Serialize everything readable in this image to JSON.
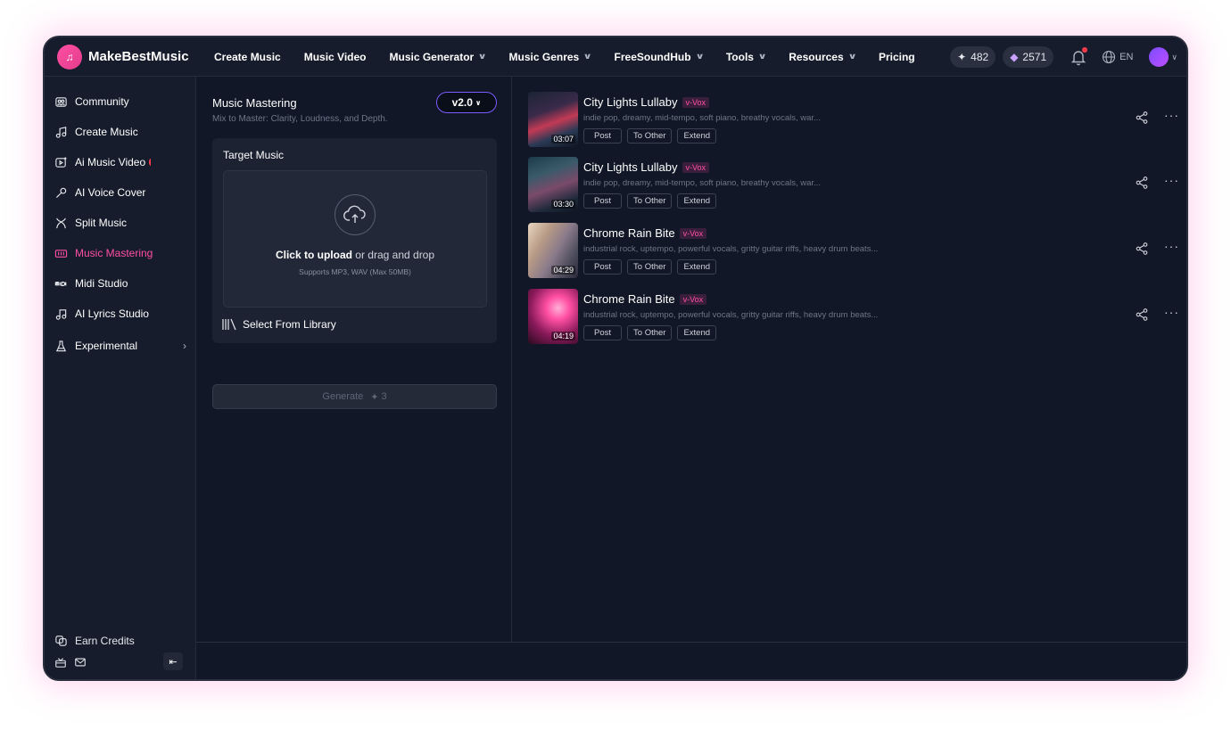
{
  "brand": {
    "name": "MakeBestMusic"
  },
  "nav": [
    {
      "label": "Create Music",
      "has_dropdown": false
    },
    {
      "label": "Music Video",
      "has_dropdown": false
    },
    {
      "label": "Music Generator",
      "has_dropdown": true
    },
    {
      "label": "Music Genres",
      "has_dropdown": true
    },
    {
      "label": "FreeSoundHub",
      "has_dropdown": true
    },
    {
      "label": "Tools",
      "has_dropdown": true
    },
    {
      "label": "Resources",
      "has_dropdown": true
    },
    {
      "label": "Pricing",
      "has_dropdown": false
    }
  ],
  "header": {
    "credits": "482",
    "gems": "2571",
    "language": "EN"
  },
  "sidebar": {
    "items": [
      {
        "label": "Community",
        "icon": "community-icon"
      },
      {
        "label": "Create Music",
        "icon": "music-note-icon"
      },
      {
        "label": "Ai Music Video",
        "icon": "video-icon"
      },
      {
        "label": "AI Voice Cover",
        "icon": "microphone-icon"
      },
      {
        "label": "Split Music",
        "icon": "split-icon"
      },
      {
        "label": "Music Mastering",
        "icon": "mastering-icon",
        "active": true
      },
      {
        "label": "Midi Studio",
        "icon": "midi-icon"
      },
      {
        "label": "AI Lyrics Studio",
        "icon": "lyrics-icon"
      },
      {
        "label": "Experimental",
        "icon": "flask-icon"
      }
    ],
    "earn_credits": "Earn Credits"
  },
  "mastering": {
    "title": "Music Mastering",
    "subtitle": "Mix to Master: Clarity, Loudness, and Depth.",
    "version": "v2.0",
    "target_label": "Target Music",
    "upload_bold": "Click to upload",
    "upload_rest": " or drag and drop",
    "upload_hint": "Supports MP3, WAV (Max 50MB)",
    "library": "Select From Library",
    "generate": "Generate",
    "generate_cost": "3"
  },
  "songs": [
    {
      "title": "City Lights Lullaby",
      "badge": "v-Vox",
      "desc": "indie pop, dreamy, mid-tempo, soft piano, breathy vocals, war...",
      "duration": "03:07"
    },
    {
      "title": "City Lights Lullaby",
      "badge": "v-Vox",
      "desc": "indie pop, dreamy, mid-tempo, soft piano, breathy vocals, war...",
      "duration": "03:30"
    },
    {
      "title": "Chrome Rain Bite",
      "badge": "v-Vox",
      "desc": "industrial rock, uptempo, powerful vocals, gritty guitar riffs, heavy drum beats...",
      "duration": "04:29"
    },
    {
      "title": "Chrome Rain Bite",
      "badge": "v-Vox",
      "desc": "industrial rock, uptempo, powerful vocals, gritty guitar riffs, heavy drum beats...",
      "duration": "04:19"
    }
  ],
  "song_actions": {
    "post": "Post",
    "to_other": "To Other",
    "extend": "Extend"
  },
  "colors": {
    "accent": "#ff4fa3",
    "background": "#111726",
    "panel": "#161c2b"
  }
}
